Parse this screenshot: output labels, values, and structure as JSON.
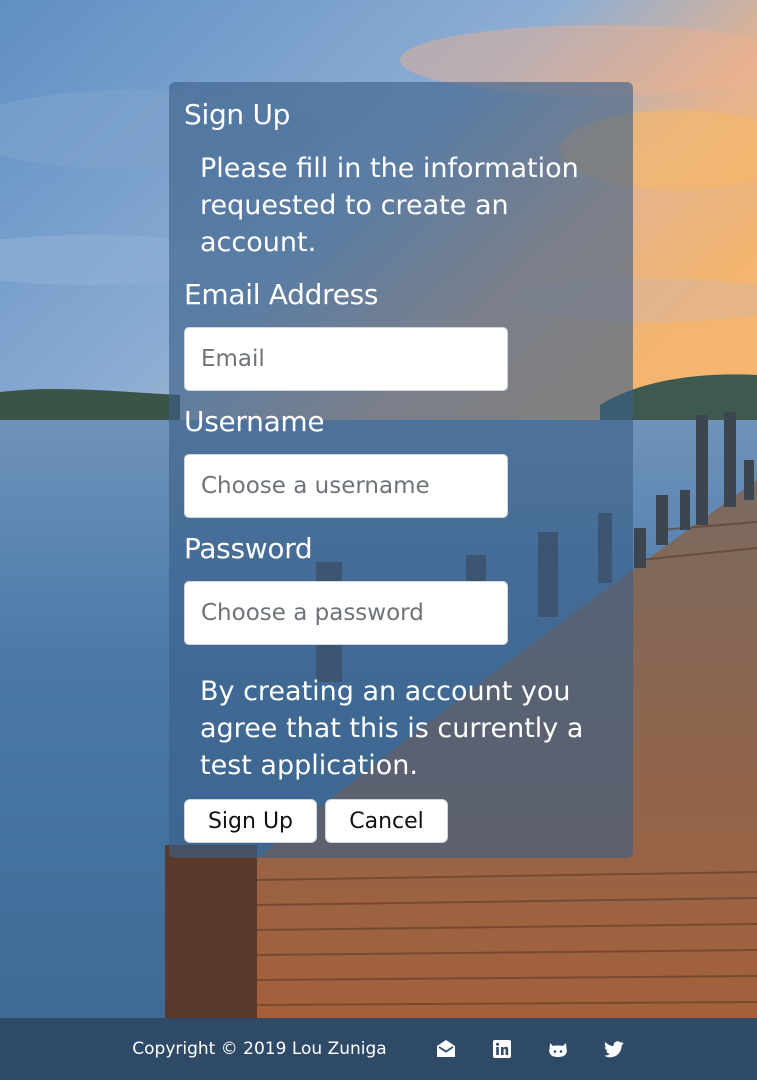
{
  "signup": {
    "title": "Sign Up",
    "intro": "Please fill in the information requested to create an account.",
    "email": {
      "label": "Email Address",
      "placeholder": "Email",
      "value": ""
    },
    "username": {
      "label": "Username",
      "placeholder": "Choose a username",
      "value": ""
    },
    "password": {
      "label": "Password",
      "placeholder": "Choose a password",
      "value": ""
    },
    "terms": "By creating an account you agree that this is currently a test application.",
    "submit_label": "Sign Up",
    "cancel_label": "Cancel"
  },
  "footer": {
    "copyright": "Copyright © 2019 Lou Zuniga",
    "links": [
      {
        "icon": "envelope-open-icon"
      },
      {
        "icon": "linkedin-icon"
      },
      {
        "icon": "github-icon"
      },
      {
        "icon": "twitter-icon"
      }
    ]
  },
  "colors": {
    "card_background": "#3a6088",
    "footer_background": "#2f4a66",
    "text": "#ffffff"
  }
}
